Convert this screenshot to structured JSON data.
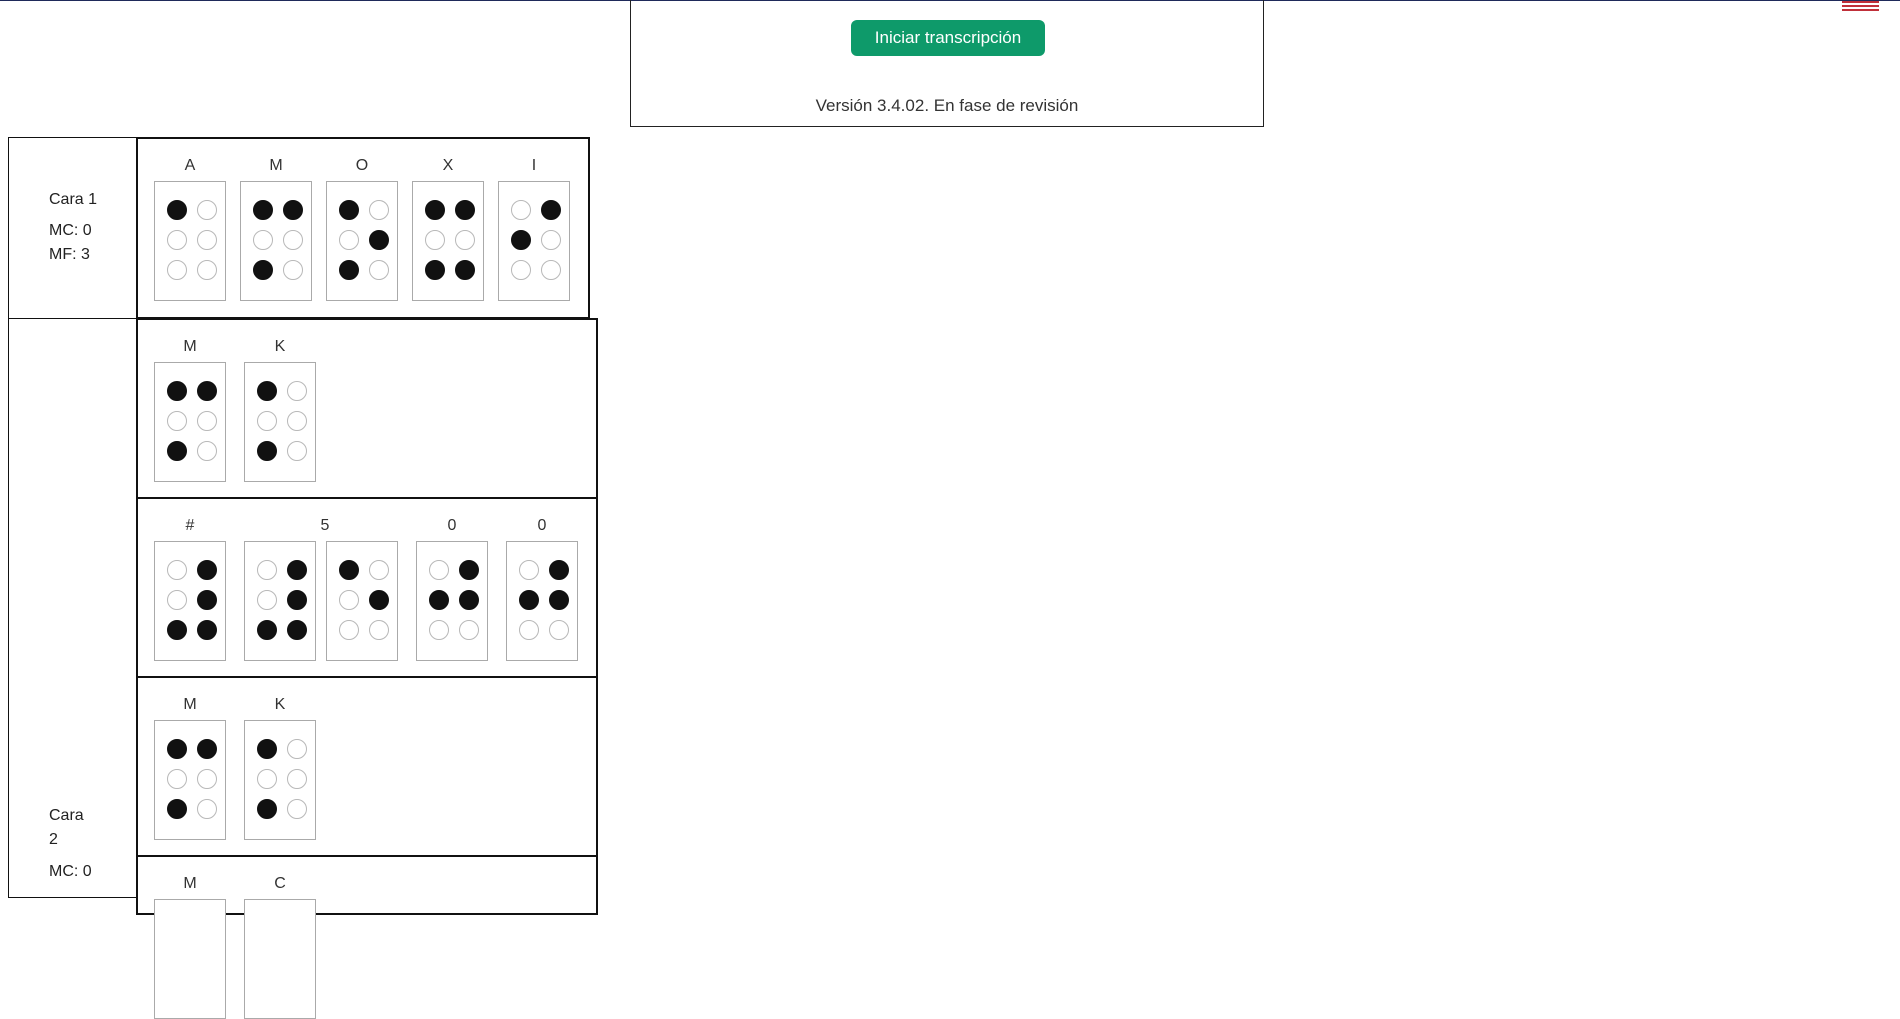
{
  "header": {
    "start_button_label": "Iniciar transcripción",
    "version_text": "Versión 3.4.02. En fase de revisión",
    "flag_icon": "flag-icon"
  },
  "faces": [
    {
      "title": "Cara 1",
      "mc": "MC: 0",
      "mf": "MF: 3",
      "lines": [
        {
          "cells": [
            {
              "letter": "A",
              "dots": [
                1,
                0,
                0,
                0,
                0,
                0
              ]
            },
            {
              "letter": "M",
              "dots": [
                1,
                1,
                0,
                0,
                1,
                0
              ]
            },
            {
              "letter": "O",
              "dots": [
                1,
                0,
                0,
                1,
                1,
                0
              ]
            },
            {
              "letter": "X",
              "dots": [
                1,
                1,
                0,
                0,
                1,
                1
              ]
            },
            {
              "letter": "I",
              "dots": [
                0,
                1,
                1,
                0,
                0,
                0
              ]
            }
          ]
        }
      ]
    },
    {
      "title_line1": "Cara",
      "title_line2": "2",
      "mc": "MC: 0",
      "lines": [
        {
          "cells": [
            {
              "letter": "M",
              "dots": [
                1,
                1,
                0,
                0,
                1,
                0
              ]
            },
            {
              "letter": "K",
              "dots": [
                1,
                0,
                0,
                0,
                1,
                0
              ]
            }
          ]
        },
        {
          "cells": [
            {
              "letter": "#",
              "dots": [
                0,
                1,
                0,
                1,
                1,
                1
              ]
            },
            {
              "letter": "5",
              "dots": [
                0,
                1,
                0,
                1,
                1,
                1
              ]
            },
            {
              "letter": "",
              "dots": [
                1,
                0,
                0,
                1,
                0,
                0
              ]
            },
            {
              "letter": "0",
              "dots": [
                0,
                1,
                1,
                1,
                0,
                0
              ]
            },
            {
              "letter": "0",
              "dots": [
                0,
                1,
                1,
                1,
                0,
                0
              ]
            }
          ]
        },
        {
          "cells": [
            {
              "letter": "M",
              "dots": [
                1,
                1,
                0,
                0,
                1,
                0
              ]
            },
            {
              "letter": "K",
              "dots": [
                1,
                0,
                0,
                0,
                1,
                0
              ]
            }
          ]
        },
        {
          "cells": [
            {
              "letter": "M",
              "dots": []
            },
            {
              "letter": "C",
              "dots": []
            }
          ]
        }
      ]
    }
  ]
}
